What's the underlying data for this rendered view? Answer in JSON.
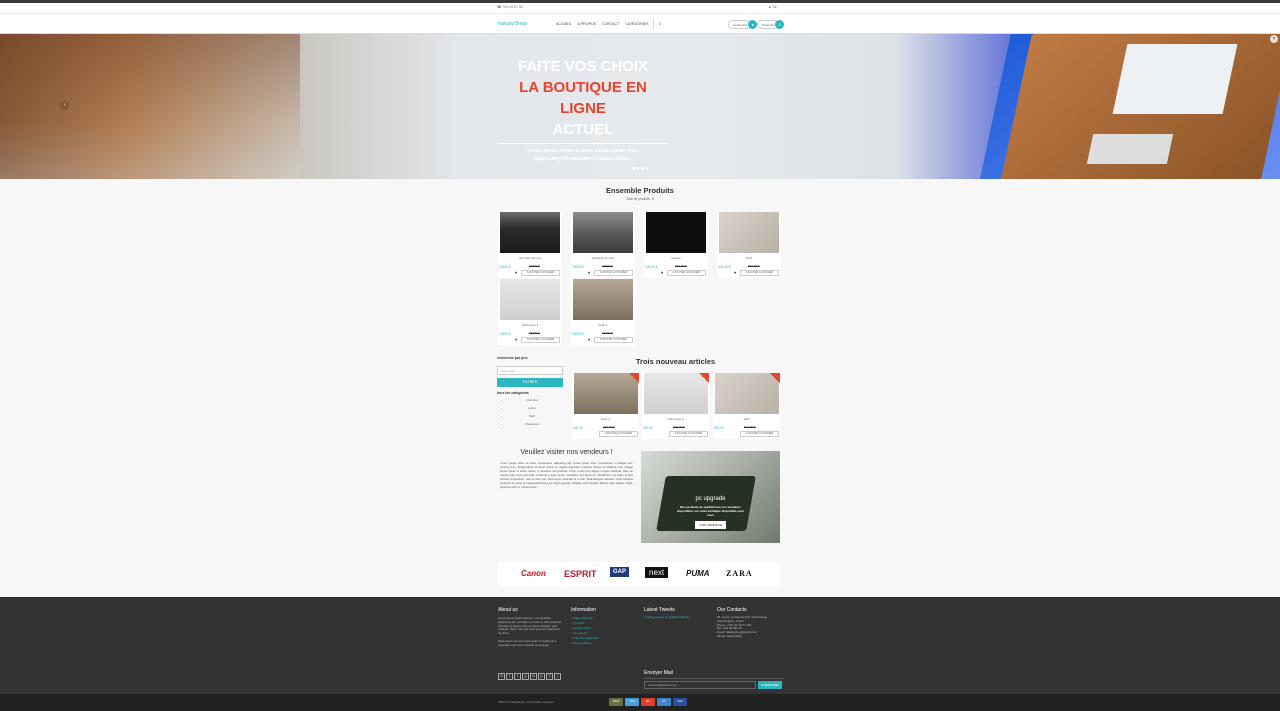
{
  "topbar": {
    "phone": "+84 00 67 55",
    "login": "Se"
  },
  "navbar": {
    "logo": "hakatyShop",
    "nav": [
      "ACCUEIL",
      "A PROPOS",
      "CONTACT",
      "CATÉGORIES"
    ],
    "connexion": "Connexion",
    "register": "S'inscrire",
    "cart_count": "0"
  },
  "hero": {
    "line1": "FAITE VOS CHOIX",
    "line2": "LA BOUTIQUE EN LIGNE",
    "line3": "ACTUEL",
    "sub1": "Lorem ipsum dolor sit amet consectetuer diam",
    "sub2": "adipiscing elit euismod ut laoreet dolore.",
    "slide_count": 4,
    "prev_symbol": "‹",
    "close_symbol": "×"
  },
  "products": {
    "title": "Ensemble Produits",
    "subtitle": "Total de produits : 6",
    "add_label": "AJOUTER AU PANIER",
    "heart": "♥",
    "items": [
      {
        "name": "chemise homme",
        "price": "10000 $",
        "old": "15000 $"
      },
      {
        "name": "pochette de mac",
        "price": "15000 $",
        "old": "20000 $"
      },
      {
        "name": "casque",
        "price": "100.00 $",
        "old": "150.00 $"
      },
      {
        "name": "Tech",
        "price": "400.00 $",
        "old": "500.00 $"
      },
      {
        "name": "chaussure 3",
        "price": "10000 $",
        "old": "15000 $"
      },
      {
        "name": "botte 1",
        "price": "10000 $",
        "old": "15000 $"
      }
    ]
  },
  "filter": {
    "title": "recherche par prix",
    "placeholder": "Entrer prix",
    "button": "FILTRER",
    "categories_title": "tous les catégories",
    "categories": [
      {
        "bullet": "›",
        "label": "chemise"
      },
      {
        "bullet": "›",
        "label": "pilote"
      },
      {
        "bullet": "›",
        "label": "Tech"
      },
      {
        "bullet": "›",
        "label": "Chaussure"
      }
    ]
  },
  "new_items": {
    "title": "Trois nouveau articles",
    "add_label": "AJOUTER AU PANIER",
    "items": [
      {
        "name": "botte 1",
        "price": "100.00",
        "old": "150.00 $"
      },
      {
        "name": "chaussure 3",
        "price": "250.00",
        "old": "300.00 $"
      },
      {
        "name": "Tech",
        "price": "400.00",
        "old": "500.00 $"
      }
    ]
  },
  "vendors": {
    "title": "Veuillez visiter nos vendeurs !",
    "text": "Lorem ipsum dolor sit amet, consectetur adipiscing elit. Fusce quam dolor, consectetur ut aliquet nec, cursus id ex. Suspendisse sit amet metus eu sapien dignissim molestie. Donec at eleifend erat. Integer luctus ipsum a lorem varius, in faucibus nisi pulvinar. Proin a velit sed augue congue vehicula. Nam ac mauris eget eros venenatis maximus a eget ipsum. Curabitur sed lacus ex. Vestibulum vel tellus id felis ultricies fermentum. Sed et velit non nisl tempor vehicula id a odio. Pellentesque habitant morbi tristique senectus et netus et malesuada fames ac turpis egestas. Aliquam erat volutpat. Mauris vitae sapien mollis, pharetra nibh ut, ornare lorem."
  },
  "promo": {
    "title": "pc upgrade",
    "desc": "Nos produits de qualité tous nos vendeurs disponibles sur notre boutique disponible pour vous",
    "button": "VOIR VENDEUR"
  },
  "brands": [
    "Canon",
    "ESPRIT",
    "GAP",
    "next",
    "PUMA",
    "ZARA"
  ],
  "footer": {
    "about_title": "About us",
    "about_text": "Lorem ipsum dolor sit amet, consectetuer adipiscing elit, sed diam no nummy nibh euismod tincidunt ut laoreet dolore magna aliquam erat volutpat. Notre site web vous propose beaucoup de choix.",
    "about_text2": "Duis autem vel eum iriure dolor in hendrerit in vulputate velit esse molestie consequat.",
    "info_title": "Information",
    "info_links": [
      "Page d'accueil",
      "A propos",
      "Compte client",
      "Voir panier",
      "Tous les catégories",
      "Voir vendeurs"
    ],
    "tweets_title": "Latest Tweets",
    "tweet": "Loading tweets by @twitterhakaty...",
    "contacts_title": "Our Contacts",
    "contacts": [
      "95, Lorem Le Dentes Port d'Artemango",
      "Antananarivo, Tuléar",
      "Phone: +261 34 43 67 234",
      "Fax: 034 00 466 22",
      "Email: hakatyshop@gmail.com",
      "Skype: hakatyShop"
    ],
    "social": [
      "S",
      "f",
      "t",
      "g",
      "in",
      "p",
      "V",
      "r"
    ],
    "mail_title": "Envoyer Mail",
    "mail_placeholder": "votremail@gmail.com",
    "mail_button": "SUBSCRIBE"
  },
  "bottombar": {
    "copyright": "2023 © hakatyShop - Tous droits réservés",
    "payments": [
      "AMEX",
      "VISA",
      "MC",
      "PP",
      "VISA"
    ]
  },
  "colors": {
    "accent": "#2bb6c0",
    "hero_red": "#e8432c",
    "footer": "#333333"
  }
}
